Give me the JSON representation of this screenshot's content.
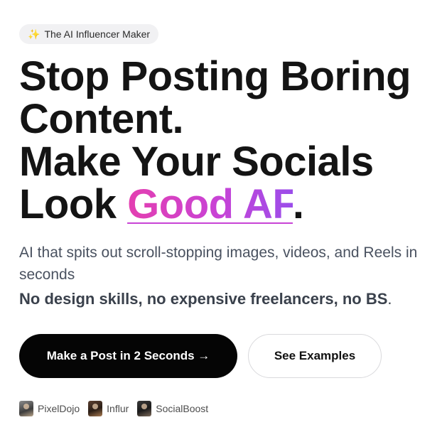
{
  "badge": {
    "icon": "sparkle-icon",
    "label": "The AI Influencer Maker"
  },
  "headline": {
    "line1": "Stop Posting Boring",
    "line2": "Content.",
    "line3": "Make Your Socials",
    "line4_prefix": "Look ",
    "line4_highlight": "Good AF",
    "line4_suffix": "."
  },
  "subheadline": "AI that spits out scroll-stopping images, videos, and Reels in seconds",
  "tagline": {
    "text": "No design skills, no expensive freelancers, no BS",
    "suffix": "."
  },
  "buttons": {
    "primary": "Make a Post in 2 Seconds →",
    "secondary": "See Examples"
  },
  "brands": [
    {
      "name": "PixelDojo"
    },
    {
      "name": "Influr"
    },
    {
      "name": "SocialBoost"
    }
  ],
  "colors": {
    "highlight_start": "#e43fb0",
    "highlight_end": "#9b4dea",
    "primary_button": "#050505"
  }
}
